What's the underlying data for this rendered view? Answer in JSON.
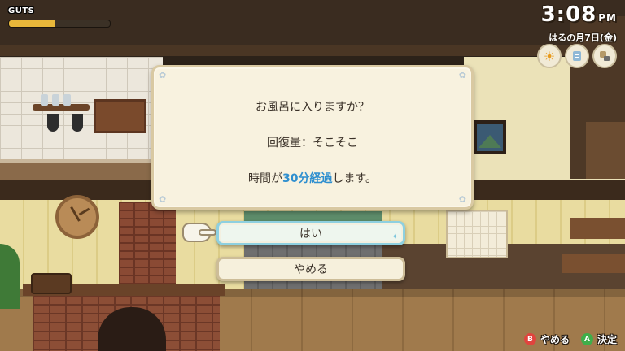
{
  "hud": {
    "guts_label": "GUTS",
    "guts_fill_fraction": 0.46,
    "guts_color": "#e8b73a",
    "time": "3:08",
    "ampm": "PM",
    "date": "はるの月7日(金)",
    "status_icons": [
      "sun-weather-icon",
      "tomorrow-weather-icon",
      "tool-icon"
    ]
  },
  "dialog": {
    "line1": "お風呂に入りますか？",
    "line2": "回復量：そこそこ",
    "line3_prefix": "時間が",
    "line3_highlight": "30分経過",
    "line3_suffix": "します。",
    "highlight_color": "#2f8fcf"
  },
  "choices": {
    "yes": "はい",
    "no": "やめる"
  },
  "hints": {
    "b_button": "B",
    "b_label": "やめる",
    "b_color": "#e0443e",
    "a_button": "A",
    "a_label": "決定",
    "a_color": "#3fae4a"
  }
}
